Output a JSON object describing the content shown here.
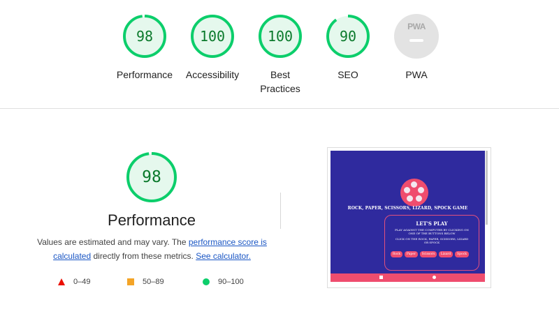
{
  "scores": [
    {
      "label": "Performance",
      "value": "98",
      "fraction": 0.98
    },
    {
      "label": "Accessibility",
      "value": "100",
      "fraction": 1.0
    },
    {
      "label_line1": "Best",
      "label_line2": "Practices",
      "value": "100",
      "fraction": 1.0
    },
    {
      "label": "SEO",
      "value": "90",
      "fraction": 0.9
    },
    {
      "label": "PWA",
      "badge_text": "PWA"
    }
  ],
  "performance": {
    "score": "98",
    "fraction": 0.98,
    "title": "Performance",
    "desc_prefix": "Values are estimated and may vary. The ",
    "desc_link1": "performance score is calculated",
    "desc_middle": " directly from these metrics. ",
    "desc_link2": "See calculator."
  },
  "legend": [
    {
      "range": "0–49",
      "shape": "triangle",
      "color": "#eb0f00"
    },
    {
      "range": "50–89",
      "shape": "square",
      "color": "#f4a427"
    },
    {
      "range": "90–100",
      "shape": "circle",
      "color": "#0cce6b"
    }
  ],
  "screenshot": {
    "title": "ROCK, PAPER, SCISSORS, LIZARD, SPOCK GAME",
    "heading": "LET'S PLAY",
    "instructions1": "PLAY AGAINST THE COMPUTER BY CLICKING ON ONE OF THE BUTTONS BELOW",
    "instructions2": "CLICK ON THE ROCK, PAPER, SCISSORS, LIZARD OR SPOCK",
    "choices": [
      "Rock",
      "Paper",
      "Scissors",
      "Lizard",
      "Spock"
    ]
  },
  "colors": {
    "pass": "#0cce6b",
    "pass_fill": "#e5f8ed",
    "pass_text": "#0b7a2c",
    "fail": "#eb0f00",
    "average": "#f4a427",
    "link": "#1a56c4"
  }
}
